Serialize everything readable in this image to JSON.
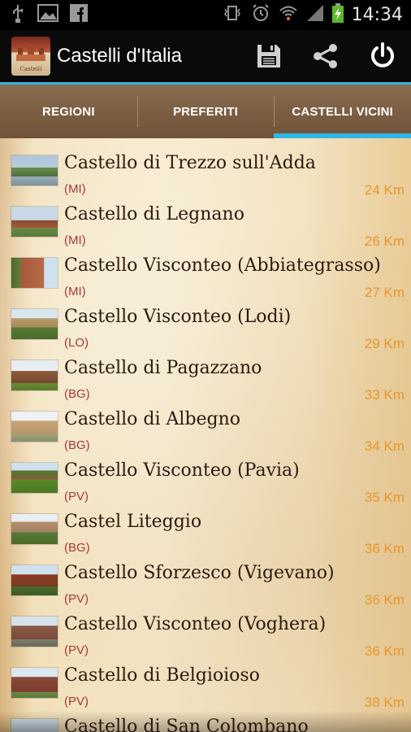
{
  "status_bar": {
    "time": "14:34"
  },
  "app": {
    "title": "Castelli d'Italia"
  },
  "tabs": [
    {
      "label": "REGIONI",
      "active": false
    },
    {
      "label": "PREFERITI",
      "active": false
    },
    {
      "label": "CASTELLI VICINI",
      "active": true
    }
  ],
  "castles": [
    {
      "name": "Castello di Trezzo sull'Adda",
      "province": "(MI)",
      "distance": "24 Km"
    },
    {
      "name": "Castello di Legnano",
      "province": "(MI)",
      "distance": "26 Km"
    },
    {
      "name": "Castello Visconteo (Abbiategrasso)",
      "province": "(MI)",
      "distance": "27 Km"
    },
    {
      "name": "Castello Visconteo (Lodi)",
      "province": "(LO)",
      "distance": "29 Km"
    },
    {
      "name": "Castello di Pagazzano",
      "province": "(BG)",
      "distance": "33 Km"
    },
    {
      "name": "Castello di Albegno",
      "province": "(BG)",
      "distance": "34 Km"
    },
    {
      "name": "Castello Visconteo (Pavia)",
      "province": "(PV)",
      "distance": "35 Km"
    },
    {
      "name": "Castel Liteggio",
      "province": "(BG)",
      "distance": "36 Km"
    },
    {
      "name": "Castello Sforzesco (Vigevano)",
      "province": "(PV)",
      "distance": "36 Km"
    },
    {
      "name": "Castello Visconteo (Voghera)",
      "province": "(PV)",
      "distance": "36 Km"
    },
    {
      "name": "Castello di Belgioioso",
      "province": "(PV)",
      "distance": "38 Km"
    },
    {
      "name": "Castello di San Colombano",
      "province": "",
      "distance": ""
    }
  ],
  "colors": {
    "accent": "#33b5e5",
    "distance": "#e8962a",
    "province": "#a63a3a"
  }
}
